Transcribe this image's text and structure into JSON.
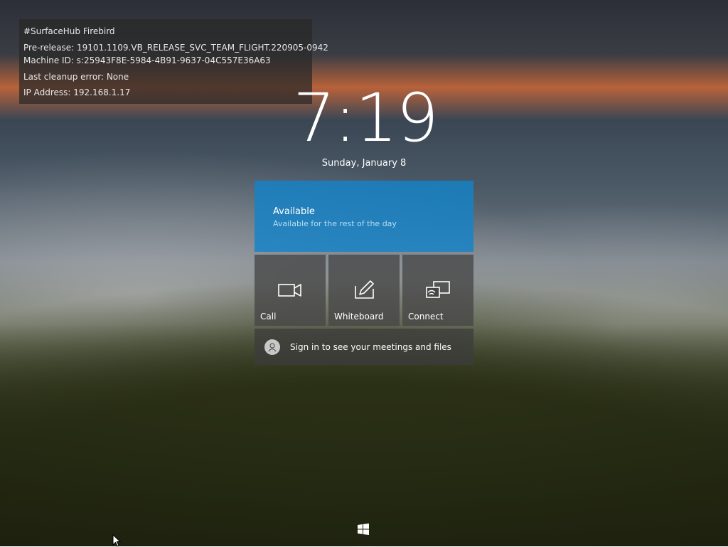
{
  "info": {
    "line1": "#SurfaceHub Firebird",
    "line2": "Pre-release: 19101.1109.VB_RELEASE_SVC_TEAM_FLIGHT.220905-0942",
    "line3": "Machine ID: s:25943F8E-5984-4B91-9637-04C557E36A63",
    "line4": "Last cleanup error: None",
    "line5": "IP Address: 192.168.1.17"
  },
  "clock": {
    "time": "7:19",
    "date": "Sunday, January 8"
  },
  "status": {
    "title": "Available",
    "subtitle": "Available for the rest of the day",
    "color": "#1482c8"
  },
  "tiles": [
    {
      "label": "Call",
      "icon": "video-camera-icon"
    },
    {
      "label": "Whiteboard",
      "icon": "pen-edit-icon"
    },
    {
      "label": "Connect",
      "icon": "cast-screen-icon"
    }
  ],
  "signin": {
    "text": "Sign in to see your meetings and files",
    "icon": "person-icon"
  },
  "device": {
    "name": ""
  },
  "taskbar": {
    "start_icon": "windows-logo-icon"
  }
}
